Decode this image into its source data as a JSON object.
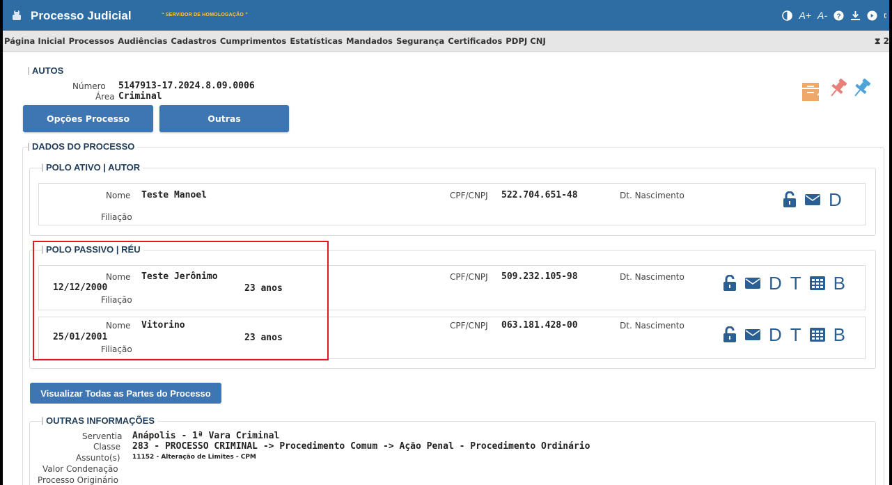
{
  "header": {
    "app_title": "Processo Judicial",
    "server_label": "“ SERVIDOR DE HOMOLOGAÇÃO ”",
    "font_increase": "A+",
    "font_decrease": "A-",
    "timer_text": "⧗ 2"
  },
  "menu": {
    "items": [
      "Página Inicial",
      "Processos",
      "Audiências",
      "Cadastros",
      "Cumprimentos",
      "Estatísticas",
      "Mandados",
      "Segurança",
      "Certificados",
      "PDPJ CNJ"
    ]
  },
  "autos": {
    "legend": "AUTOS",
    "numero_label": "Número",
    "numero_value": "5147913-17.2024.8.09.0006",
    "area_label": "Área",
    "area_value": "Criminal",
    "btn_opcoes": "Opções Processo",
    "btn_outras": "Outras"
  },
  "dados": {
    "legend": "DADOS DO PROCESSO",
    "polo_ativo": {
      "legend": "POLO ATIVO | AUTOR",
      "parties": [
        {
          "nome_label": "Nome",
          "nome": "Teste Manoel",
          "cpf_label": "CPF/CNPJ",
          "cpf": "522.704.651-48",
          "nasc_label": "Dt. Nascimento",
          "filiacao_label": "Filiação",
          "actions": [
            "lock-open-icon",
            "envelope-icon",
            "D"
          ]
        }
      ]
    },
    "polo_passivo": {
      "legend": "POLO PASSIVO | RÉU",
      "parties": [
        {
          "nome_label": "Nome",
          "nome": "Teste Jerônimo",
          "data": "12/12/2000",
          "idade": "23 anos",
          "cpf_label": "CPF/CNPJ",
          "cpf": "509.232.105-98",
          "nasc_label": "Dt. Nascimento",
          "filiacao_label": "Filiação",
          "actions": [
            "lock-open-icon",
            "envelope-icon",
            "D",
            "T",
            "table-icon",
            "B"
          ]
        },
        {
          "nome_label": "Nome",
          "nome": "Vitorino",
          "data": "25/01/2001",
          "idade": "23 anos",
          "cpf_label": "CPF/CNPJ",
          "cpf": "063.181.428-00",
          "nasc_label": "Dt. Nascimento",
          "filiacao_label": "Filiação",
          "actions": [
            "lock-open-icon",
            "envelope-icon",
            "D",
            "T",
            "table-icon",
            "B"
          ]
        }
      ]
    },
    "btn_visualizar": "Visualizar Todas as Partes do Processo"
  },
  "outras": {
    "legend": "OUTRAS INFORMAÇÕES",
    "serventia_label": "Serventia",
    "serventia": "Anápolis - 1ª Vara Criminal",
    "classe_label": "Classe",
    "classe": "283 - PROCESSO CRIMINAL -> Procedimento Comum -> Ação Penal - Procedimento Ordinário",
    "assunto_label": "Assunto(s)",
    "assunto": "11152 - Alteração de Limites - CPM",
    "valor_label": "Valor Condenação",
    "origem_label": "Processo Originário"
  },
  "colors": {
    "topbar": "#2e6da4",
    "accent": "#3d76b3",
    "icon": "#2b5f94",
    "highlight": "#e01a1a",
    "archive": "#f0a868",
    "pin_red": "#e8807a",
    "pin_blue": "#4fa3d9"
  }
}
